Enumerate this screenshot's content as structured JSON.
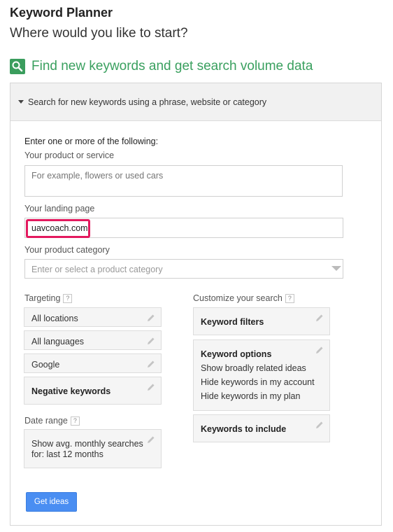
{
  "header": {
    "title": "Keyword Planner",
    "subtitle": "Where would you like to start?"
  },
  "section": {
    "title": "Find new keywords and get search volume data",
    "panel_title": "Search for new keywords using a phrase, website or category"
  },
  "form": {
    "intro": "Enter one or more of the following:",
    "product_label": "Your product or service",
    "product_placeholder": "For example, flowers or used cars",
    "landing_label": "Your landing page",
    "landing_value": "uavcoach.com",
    "category_label": "Your product category",
    "category_placeholder": "Enter or select a product category"
  },
  "targeting": {
    "label": "Targeting",
    "help": "?",
    "items": [
      "All locations",
      "All languages",
      "Google"
    ],
    "negative": "Negative keywords"
  },
  "date_range": {
    "label": "Date range",
    "help": "?",
    "line1": "Show avg. monthly searches",
    "line2": "for: last 12 months"
  },
  "customize": {
    "label": "Customize your search",
    "help": "?",
    "filters": "Keyword filters",
    "options_title": "Keyword options",
    "options": [
      "Show broadly related ideas",
      "Hide keywords in my account",
      "Hide keywords in my plan"
    ],
    "include": "Keywords to include"
  },
  "actions": {
    "get_ideas": "Get ideas"
  },
  "icons": {
    "search": "search-icon",
    "pencil": "pencil-icon",
    "help": "help-icon",
    "caret": "caret-down-icon",
    "dropdown": "dropdown-arrow-icon"
  }
}
